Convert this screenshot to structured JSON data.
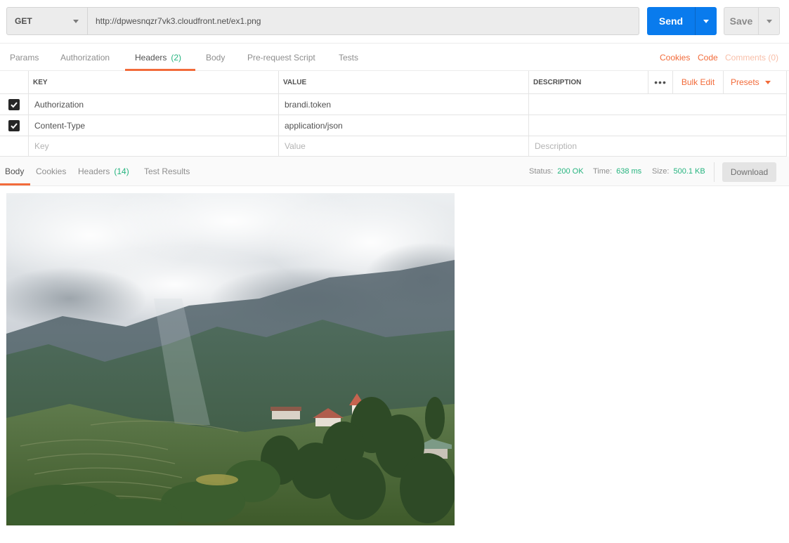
{
  "request": {
    "method": "GET",
    "url": "http://dpwesnqzr7vk3.cloudfront.net/ex1.png",
    "send_label": "Send",
    "save_label": "Save"
  },
  "tabs": {
    "params": "Params",
    "authorization": "Authorization",
    "headers": "Headers",
    "headers_count": "(2)",
    "body": "Body",
    "prerequest": "Pre-request Script",
    "tests": "Tests",
    "cookies": "Cookies",
    "code": "Code",
    "comments": "Comments (0)"
  },
  "headers_table": {
    "col_key": "KEY",
    "col_value": "VALUE",
    "col_description": "DESCRIPTION",
    "more": "•••",
    "bulk_edit": "Bulk Edit",
    "presets": "Presets",
    "rows": [
      {
        "checked": true,
        "key": "Authorization",
        "value": "brandi.token",
        "description": ""
      },
      {
        "checked": true,
        "key": "Content-Type",
        "value": "application/json",
        "description": ""
      }
    ],
    "placeholder": {
      "key": "Key",
      "value": "Value",
      "description": "Description"
    }
  },
  "response": {
    "tabs": {
      "body": "Body",
      "cookies": "Cookies",
      "headers": "Headers",
      "headers_count": "(14)",
      "test_results": "Test Results"
    },
    "status_label": "Status:",
    "status_value": "200 OK",
    "time_label": "Time:",
    "time_value": "638 ms",
    "size_label": "Size:",
    "size_value": "500.1 KB",
    "download_label": "Download"
  },
  "colors": {
    "accent": "#f26b3a",
    "send": "#097bed",
    "success": "#26b47f"
  },
  "preview": {
    "image_icon": "landscape-photo"
  }
}
